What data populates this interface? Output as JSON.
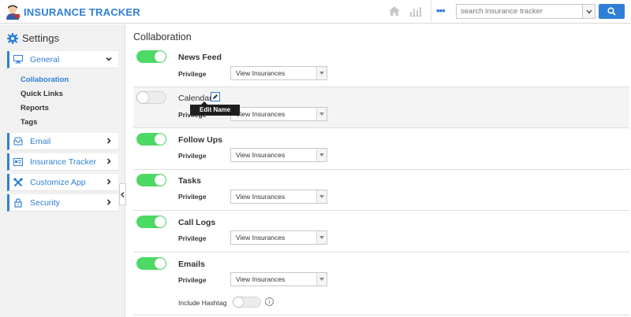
{
  "header": {
    "app_title": "INSURANCE TRACKER",
    "search_placeholder": "search insurance tracker",
    "more_label": "•••",
    "accent_color": "#2f7fd6"
  },
  "sidebar": {
    "title": "Settings",
    "items": [
      {
        "label": "General",
        "icon": "monitor-icon",
        "expanded": true
      },
      {
        "label": "Email",
        "icon": "inbox-icon"
      },
      {
        "label": "Insurance Tracker",
        "icon": "card-icon"
      },
      {
        "label": "Customize App",
        "icon": "tools-icon"
      },
      {
        "label": "Security",
        "icon": "lock-icon"
      }
    ],
    "sub_items": [
      {
        "label": "Collaboration",
        "active": true
      },
      {
        "label": "Quick Links"
      },
      {
        "label": "Reports"
      },
      {
        "label": "Tags"
      }
    ]
  },
  "main": {
    "title": "Collaboration",
    "privilege_label": "Privilege",
    "rows": [
      {
        "title": "News Feed",
        "enabled": true,
        "privilege": "View Insurances"
      },
      {
        "title": "Calendar",
        "enabled": false,
        "privilege": "View Insurances"
      },
      {
        "title": "Follow Ups",
        "enabled": true,
        "privilege": "View Insurances"
      },
      {
        "title": "Tasks",
        "enabled": true,
        "privilege": "View Insurances"
      },
      {
        "title": "Call Logs",
        "enabled": true,
        "privilege": "View Insurances"
      },
      {
        "title": "Emails",
        "enabled": true,
        "privilege": "View Insurances",
        "extra_label": "Include Hashtag",
        "extra_enabled": false
      }
    ],
    "tooltip": "Edit Name"
  },
  "colors": {
    "toggle_on": "#4cd964",
    "toggle_off": "#ececec"
  }
}
